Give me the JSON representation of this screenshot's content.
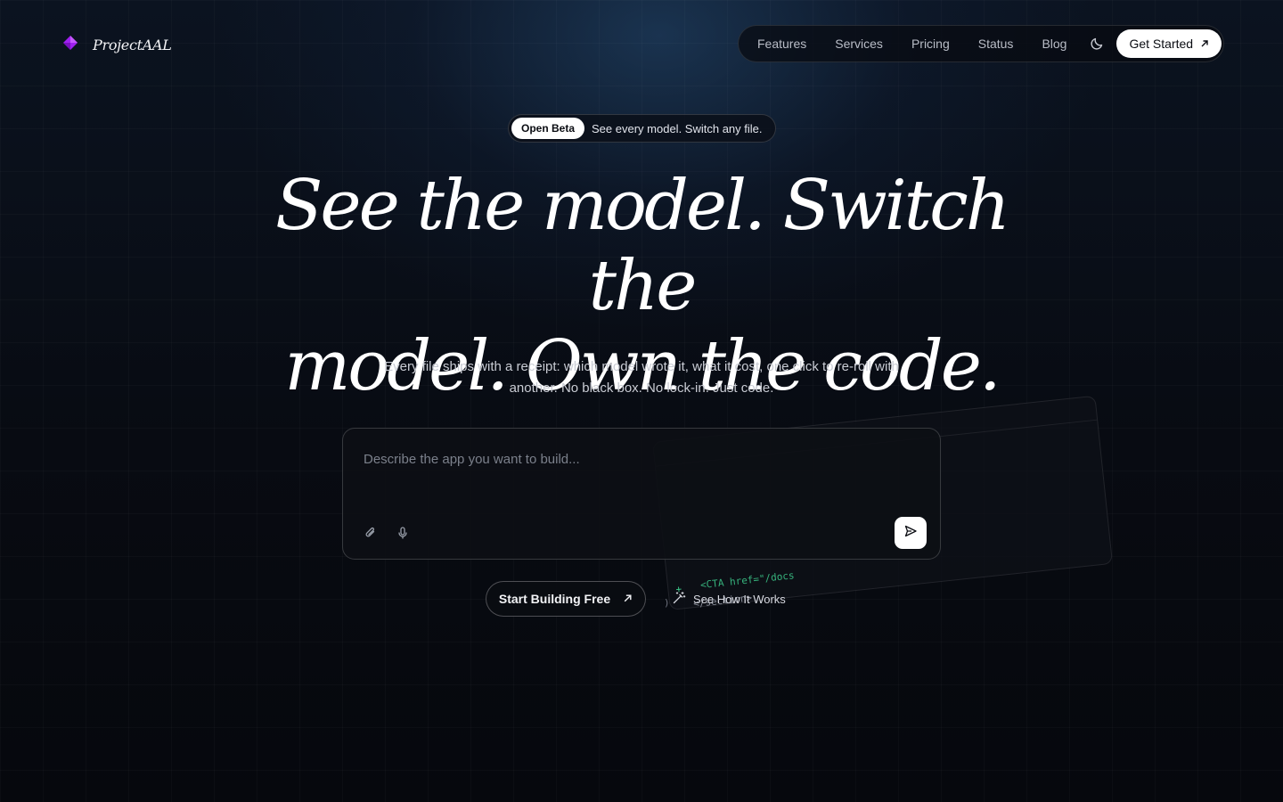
{
  "brand": {
    "name": "ProjectAAL",
    "logo_color": "#a020f0"
  },
  "nav": {
    "links": [
      "Features",
      "Services",
      "Pricing",
      "Status",
      "Blog"
    ],
    "cta_label": "Get Started",
    "theme_icon": "moon-icon"
  },
  "badge": {
    "pill": "Open Beta",
    "text": "See every model. Switch any file."
  },
  "hero": {
    "title_line1": "See the model. Switch the",
    "title_line2": "model. Own the code.",
    "subtitle": "Every file ships with a receipt: which model wrote it, what it cost, one click to re-roll with another. No black box. No lock-in. Just code."
  },
  "prompt": {
    "placeholder": "Describe the app you want to build...",
    "value": "",
    "attach_icon": "paperclip-icon",
    "mic_icon": "microphone-icon",
    "send_icon": "send-icon"
  },
  "code_preview": {
    "lines": [
      {
        "marker": "+",
        "text": "<CTA href=\"/docs"
      },
      {
        "marker": "",
        "text": "</section>"
      },
      {
        "marker": "",
        "text": ")"
      }
    ],
    "added_color": "#3ecf8e"
  },
  "actions": {
    "primary_label": "Start Building Free",
    "secondary_label": "See How It Works",
    "secondary_icon": "magic-wand-icon"
  }
}
